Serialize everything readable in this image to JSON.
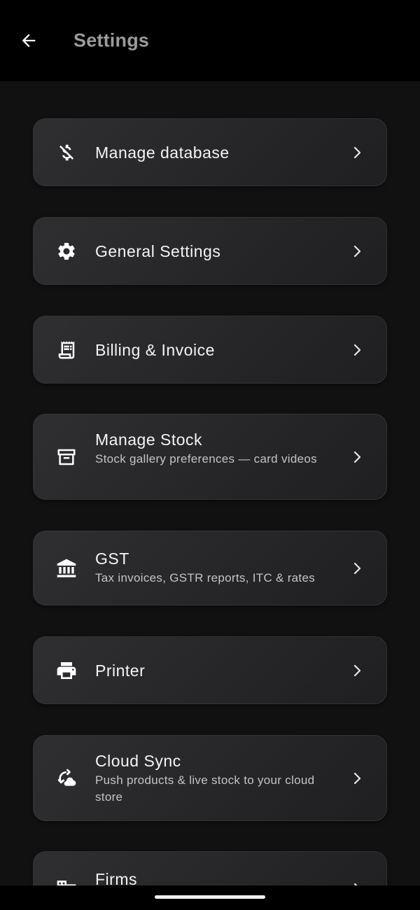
{
  "header": {
    "title": "Settings",
    "back_icon": "arrow-left-icon"
  },
  "items": [
    {
      "title": "Manage database",
      "subtitle": "",
      "icon": "database-off-icon"
    },
    {
      "title": "General Settings",
      "subtitle": "",
      "icon": "gear-icon"
    },
    {
      "title": "Billing & Invoice",
      "subtitle": "",
      "icon": "receipt-icon"
    },
    {
      "title": "Manage Stock",
      "subtitle": "Stock gallery preferences — card videos",
      "icon": "archive-box-icon"
    },
    {
      "title": "GST",
      "subtitle": "Tax invoices, GSTR reports, ITC & rates",
      "icon": "bank-icon"
    },
    {
      "title": "Printer",
      "subtitle": "",
      "icon": "printer-icon"
    },
    {
      "title": "Cloud Sync",
      "subtitle": "Push products & live stock to your cloud store",
      "icon": "cloud-sync-icon"
    },
    {
      "title": "Firms",
      "subtitle": "",
      "icon": "building-icon"
    }
  ],
  "colors": {
    "background": "#111111",
    "appbar": "#000000",
    "card": "#2a2a2c",
    "title_text": "#9b9b9b"
  }
}
